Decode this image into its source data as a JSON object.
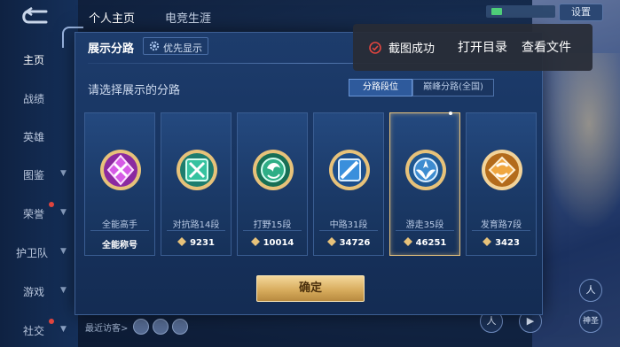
{
  "sidebar": {
    "items": [
      {
        "label": "主页",
        "active": true,
        "chevron": false
      },
      {
        "label": "战绩",
        "active": false,
        "chevron": false
      },
      {
        "label": "英雄",
        "active": false,
        "chevron": false
      },
      {
        "label": "图鉴",
        "active": false,
        "chevron": true
      },
      {
        "label": "荣誉",
        "active": false,
        "chevron": true
      },
      {
        "label": "护卫队",
        "active": false,
        "chevron": true
      },
      {
        "label": "游戏",
        "active": false,
        "chevron": true
      },
      {
        "label": "社交",
        "active": false,
        "chevron": true
      }
    ]
  },
  "top_tabs": [
    "个人主页",
    "电竞生涯"
  ],
  "top_right": {
    "settings_label": "设置"
  },
  "bottom": {
    "recent_visitors": "最近访客>"
  },
  "right_controls": [
    "人",
    "▶",
    "神圣"
  ],
  "modal": {
    "title": "展示分路",
    "priority_label": "优先显示",
    "prompt": "请选择展示的分路",
    "tabs": [
      {
        "label": "分路段位",
        "active": true
      },
      {
        "label": "巅峰分路(全国)",
        "active": false
      }
    ],
    "cards": [
      {
        "name": "全能高手",
        "score": "全能称号",
        "has_points": false,
        "emblem_color": "#c33ad0",
        "selected": false
      },
      {
        "name": "对抗路14段",
        "score": "9231",
        "has_points": true,
        "emblem_color": "#2bb89a",
        "selected": false
      },
      {
        "name": "打野15段",
        "score": "10014",
        "has_points": true,
        "emblem_color": "#27a777",
        "selected": false
      },
      {
        "name": "中路31段",
        "score": "34726",
        "has_points": true,
        "emblem_color": "#2f7ec4",
        "selected": false
      },
      {
        "name": "游走35段",
        "score": "46251",
        "has_points": true,
        "emblem_color": "#3a86c9",
        "selected": true
      },
      {
        "name": "发育路7段",
        "score": "3423",
        "has_points": true,
        "emblem_color": "#e09a39",
        "selected": false
      }
    ],
    "confirm_label": "确定"
  },
  "toast": {
    "message": "截图成功",
    "open_dir": "打开目录",
    "view_file": "查看文件",
    "icon_color": "#e1453f"
  }
}
